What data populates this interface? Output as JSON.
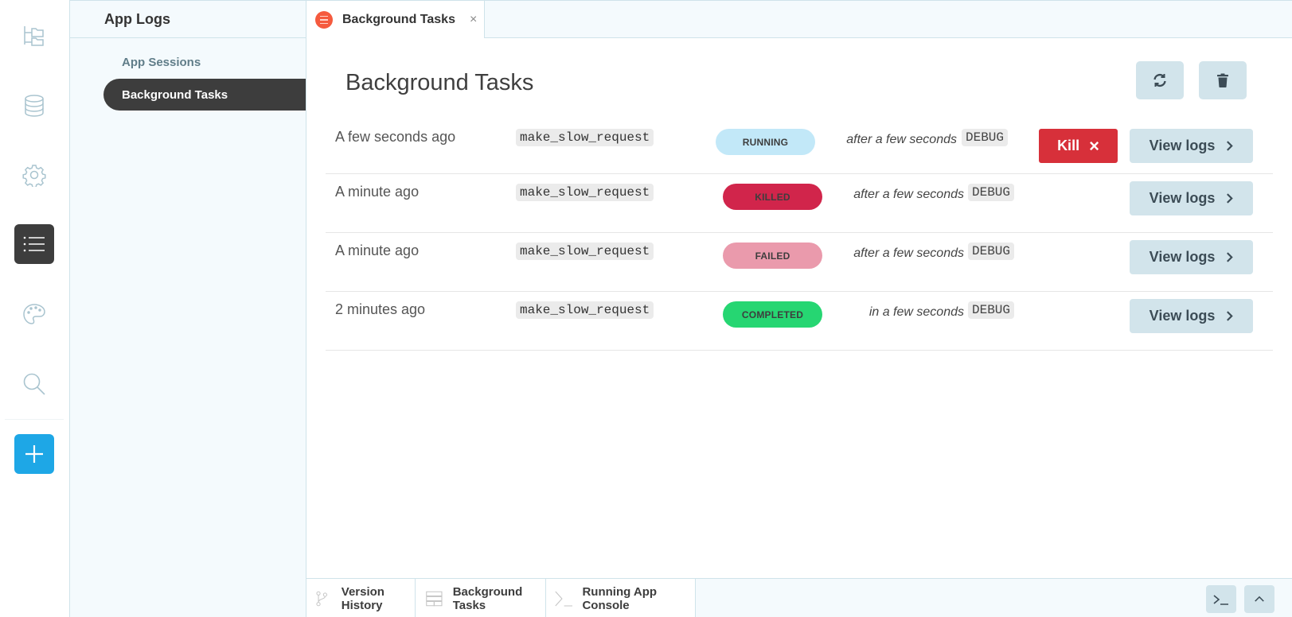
{
  "rail": {
    "items": [
      {
        "icon": "folder-tree-icon",
        "label": "Files"
      },
      {
        "icon": "database-icon",
        "label": "Database"
      },
      {
        "icon": "gear-icon",
        "label": "Settings"
      },
      {
        "icon": "list-icon",
        "label": "App Logs",
        "active": true
      },
      {
        "icon": "palette-icon",
        "label": "Theme"
      },
      {
        "icon": "search-icon",
        "label": "Search"
      },
      {
        "icon": "plus-icon",
        "label": "Add"
      }
    ]
  },
  "sidebar": {
    "title": "App Logs",
    "items": [
      {
        "label": "App Sessions",
        "selected": false
      },
      {
        "label": "Background Tasks",
        "selected": true
      }
    ]
  },
  "tabs": [
    {
      "label": "Background Tasks",
      "icon": "background-tasks-icon",
      "close": "×"
    }
  ],
  "main": {
    "title": "Background Tasks",
    "refresh_button": "refresh-icon",
    "delete_button": "trash-icon",
    "tasks": [
      {
        "time": "A few seconds ago",
        "name": "make_slow_request",
        "status": "RUNNING",
        "status_color": "#c2e8f8",
        "eta": "after a few seconds",
        "level": "DEBUG",
        "kill_label": "Kill",
        "kill_icon": "×",
        "view_label": "View logs"
      },
      {
        "time": "A minute ago",
        "name": "make_slow_request",
        "status": "KILLED",
        "status_color": "#d1254b",
        "eta": "after a few seconds",
        "level": "DEBUG",
        "view_label": "View logs"
      },
      {
        "time": "A minute ago",
        "name": "make_slow_request",
        "status": "FAILED",
        "status_color": "#ea9aac",
        "eta": "after a few seconds",
        "level": "DEBUG",
        "view_label": "View logs"
      },
      {
        "time": "2 minutes ago",
        "name": "make_slow_request",
        "status": "COMPLETED",
        "status_color": "#26d672",
        "eta": "in a few seconds",
        "level": "DEBUG",
        "view_label": "View logs"
      }
    ]
  },
  "bottombar": {
    "tabs": [
      {
        "label": "Version History",
        "icon": "git-branch-icon"
      },
      {
        "label": "Background Tasks",
        "icon": "tasks-grid-icon"
      },
      {
        "label": "Running App Console",
        "icon": "terminal-icon"
      }
    ],
    "console_button": "terminal-icon",
    "expand_button": "chevron-up-icon"
  },
  "colors": {
    "accent": "#1ea7e6",
    "active_dark": "#3d3d3d",
    "kill_red": "#d7303a",
    "button_blue": "#d2e4eb",
    "tab_icon": "#f55a3e"
  }
}
